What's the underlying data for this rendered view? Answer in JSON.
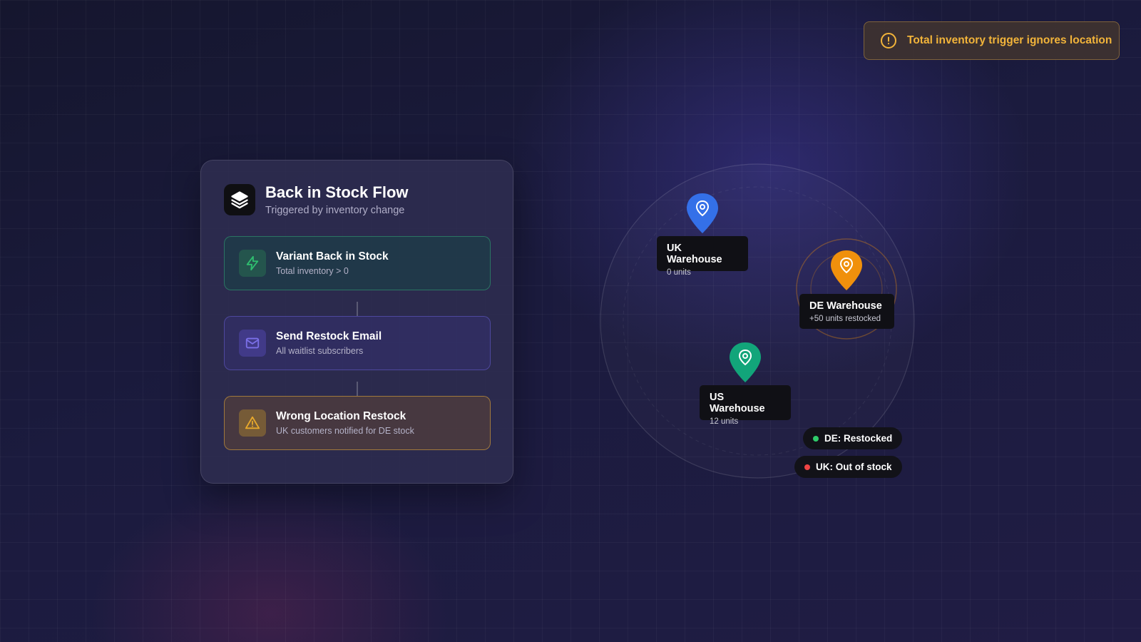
{
  "alert": {
    "text": "Total inventory trigger ignores location",
    "icon": "alert-circle-icon",
    "color": "#f2b43a"
  },
  "flow": {
    "title": "Back in Stock Flow",
    "subtitle": "Triggered by inventory change",
    "logo_icon": "layers-icon",
    "steps": [
      {
        "title": "Variant Back in Stock",
        "subtitle": "Total inventory > 0",
        "icon": "lightning-icon",
        "color": "#2fbf6f"
      },
      {
        "title": "Send Restock Email",
        "subtitle": "All waitlist subscribers",
        "icon": "mail-icon",
        "color": "#7b70e8"
      },
      {
        "title": "Wrong Location Restock",
        "subtitle": "UK customers notified for DE stock",
        "icon": "warning-icon",
        "color": "#e8a92c"
      }
    ]
  },
  "warehouses": [
    {
      "name": "UK Warehouse",
      "units": "0 units",
      "color": "#3470e8"
    },
    {
      "name": "DE Warehouse",
      "units": "+50 units restocked",
      "color": "#f0900c"
    },
    {
      "name": "US Warehouse",
      "units": "12 units",
      "color": "#12a57a"
    }
  ],
  "legend": [
    {
      "label": "DE: Restocked",
      "color": "#2fcb6a"
    },
    {
      "label": "UK: Out of stock",
      "color": "#f04444"
    }
  ]
}
